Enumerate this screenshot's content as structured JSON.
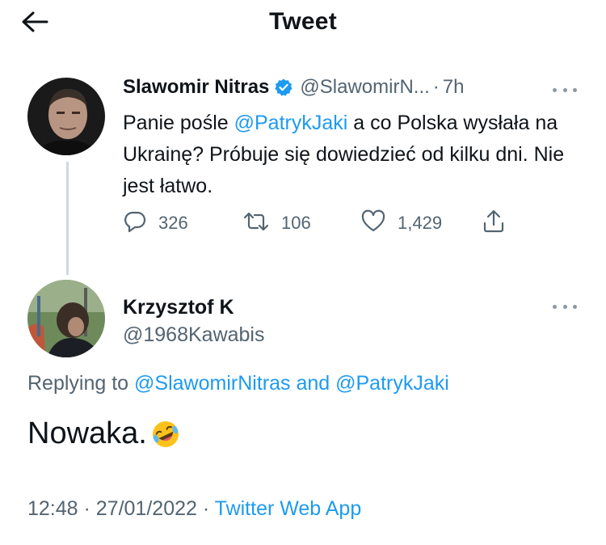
{
  "header": {
    "title": "Tweet",
    "back_icon": "arrow-left-icon"
  },
  "original_tweet": {
    "author_name": "Slawomir Nitras",
    "verified": true,
    "handle": "@SlawomirN...",
    "separator": "·",
    "time": "7h",
    "text_part1": "Panie pośle ",
    "mention": "@PatrykJaki",
    "text_part2": " a co Polska wysłała na Ukrainę? Próbuje się dowiedzieć od kilku dni. Nie jest łatwo.",
    "actions": {
      "replies": "326",
      "retweets": "106",
      "likes": "1,429"
    }
  },
  "reply_tweet": {
    "author_name": "Krzysztof K",
    "handle": "@1968Kawabis",
    "replying_prefix": "Replying to ",
    "replying_to_1": "@SlawomirNitras",
    "replying_and": " and ",
    "replying_to_2": "@PatrykJaki",
    "text": "Nowaka.",
    "emoji": "rolling-on-floor-laughing",
    "timestamp": "12:48 · 27/01/2022 · ",
    "source": "Twitter Web App"
  },
  "colors": {
    "accent": "#1d9bf0",
    "text": "#0f1419",
    "secondary": "#536471"
  }
}
